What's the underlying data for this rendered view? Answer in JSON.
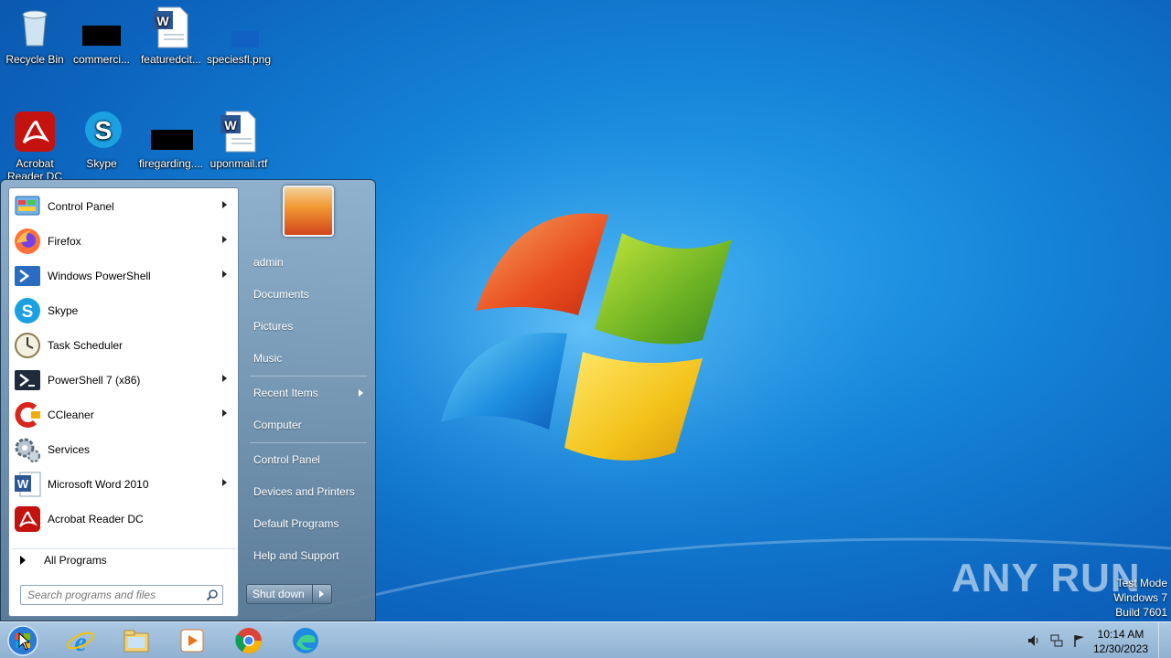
{
  "desktop": {
    "icons": [
      {
        "label": "Recycle Bin",
        "icon": "recycle-bin-icon"
      },
      {
        "label": "commerci...",
        "icon": "redacted-file-icon"
      },
      {
        "label": "featuredcit...",
        "icon": "word-document-icon"
      },
      {
        "label": "speciesfl.png",
        "icon": "png-file-icon"
      },
      {
        "label": "Acrobat Reader DC",
        "icon": "acrobat-icon"
      },
      {
        "label": "Skype",
        "icon": "skype-icon"
      },
      {
        "label": "firegarding....",
        "icon": "redacted-file-icon"
      },
      {
        "label": "uponmail.rtf",
        "icon": "word-document-icon"
      }
    ],
    "watermark": "ANY RUN",
    "build_info": [
      "Test Mode",
      "Windows 7",
      "Build 7601"
    ]
  },
  "start_menu": {
    "programs": [
      {
        "label": "Control Panel",
        "icon": "control-panel-icon",
        "submenu": true
      },
      {
        "label": "Firefox",
        "icon": "firefox-icon",
        "submenu": true
      },
      {
        "label": "Windows PowerShell",
        "icon": "powershell-icon",
        "submenu": true
      },
      {
        "label": "Skype",
        "icon": "skype-icon",
        "submenu": false
      },
      {
        "label": "Task Scheduler",
        "icon": "task-scheduler-icon",
        "submenu": false
      },
      {
        "label": "PowerShell 7 (x86)",
        "icon": "powershell7-icon",
        "submenu": true
      },
      {
        "label": "CCleaner",
        "icon": "ccleaner-icon",
        "submenu": true
      },
      {
        "label": "Services",
        "icon": "services-icon",
        "submenu": false
      },
      {
        "label": "Microsoft Word 2010",
        "icon": "word-icon",
        "submenu": true
      },
      {
        "label": "Acrobat Reader DC",
        "icon": "acrobat-icon",
        "submenu": false
      }
    ],
    "all_programs": "All Programs",
    "search_placeholder": "Search programs and files",
    "right_items": [
      {
        "label": "admin"
      },
      {
        "label": "Documents"
      },
      {
        "label": "Pictures"
      },
      {
        "label": "Music"
      },
      {
        "label": "Recent Items",
        "submenu": true
      },
      {
        "label": "Computer"
      },
      {
        "label": "Control Panel"
      },
      {
        "label": "Devices and Printers"
      },
      {
        "label": "Default Programs"
      },
      {
        "label": "Help and Support"
      }
    ],
    "shutdown_label": "Shut down"
  },
  "taskbar": {
    "apps": [
      {
        "name": "internet-explorer-icon"
      },
      {
        "name": "file-explorer-icon"
      },
      {
        "name": "media-player-icon"
      },
      {
        "name": "chrome-icon"
      },
      {
        "name": "edge-icon"
      }
    ],
    "clock_time": "10:14 AM",
    "clock_date": "12/30/2023"
  }
}
